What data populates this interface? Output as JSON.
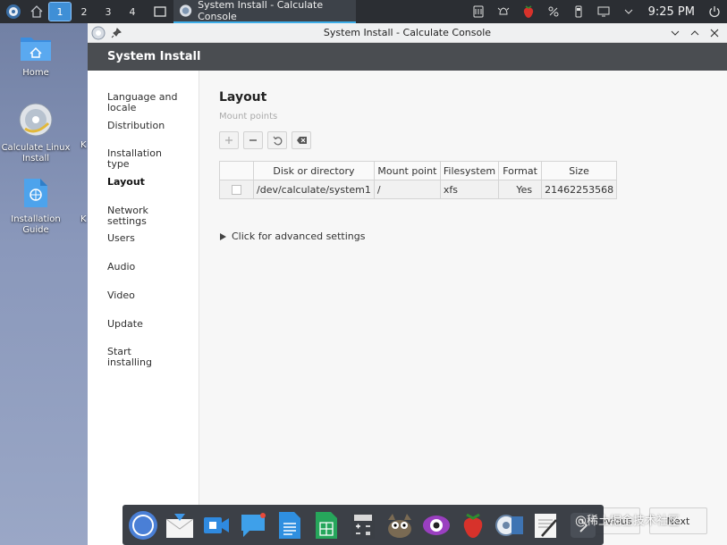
{
  "taskbar": {
    "desktops": [
      "1",
      "2",
      "3",
      "4"
    ],
    "active_desktop": "1",
    "task_title": "System Install - Calculate Console",
    "clock": "9:25 PM"
  },
  "desktop": {
    "icons": [
      {
        "label": "Home",
        "icon": "folder-home-icon"
      },
      {
        "label": "Calculate Linux Install",
        "icon": "install-disc-icon"
      },
      {
        "label": "Installation Guide",
        "icon": "guide-document-icon"
      }
    ],
    "peek": [
      "K",
      "K"
    ]
  },
  "window": {
    "title": "System Install - Calculate Console",
    "header": "System Install",
    "nav": [
      "Language and locale",
      "Distribution",
      "Installation type",
      "Layout",
      "Network settings",
      "Users",
      "Audio",
      "Video",
      "Update",
      "Start installing"
    ],
    "active_nav": "Layout",
    "section_title": "Layout",
    "section_sub": "Mount points",
    "table": {
      "columns": [
        "",
        "Disk or directory",
        "Mount point",
        "Filesystem",
        "Format",
        "Size"
      ],
      "rows": [
        {
          "disk": "/dev/calculate/system1",
          "mount": "/",
          "fs": "xfs",
          "format": "Yes",
          "size": "21462253568"
        }
      ]
    },
    "advanced_label": "Click for advanced settings",
    "buttons": {
      "previous": "Previous",
      "next": "Next"
    }
  },
  "watermark": "@稀土掘金技术社区",
  "colors": {
    "accent": "#3daee9",
    "header_bg": "#4a4d51",
    "panel_bg": "#2b2e33"
  }
}
